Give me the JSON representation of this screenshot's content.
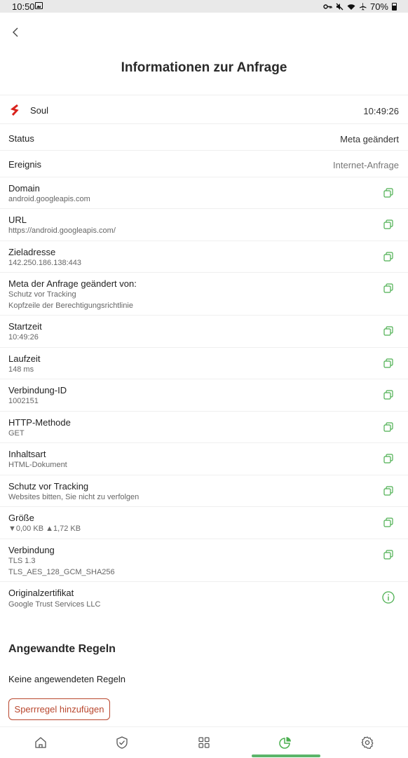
{
  "status_bar": {
    "time": "10:50",
    "battery": "70%",
    "icons": [
      "image-icon",
      "vpn-key-icon",
      "mute-icon",
      "wifi-icon",
      "airplane-icon",
      "battery-icon"
    ]
  },
  "header": {
    "title": "Informationen zur Anfrage"
  },
  "app": {
    "name": "Soul",
    "time": "10:49:26",
    "icon": "soul-logo"
  },
  "status": {
    "label": "Status",
    "value": "Meta geändert"
  },
  "event": {
    "label": "Ereignis",
    "value": "Internet-Anfrage"
  },
  "details": [
    {
      "label": "Domain",
      "lines": [
        "android.googleapis.com"
      ]
    },
    {
      "label": "URL",
      "lines": [
        "https://android.googleapis.com/"
      ]
    },
    {
      "label": "Zieladresse",
      "lines": [
        "142.250.186.138:443"
      ]
    },
    {
      "label": "Meta der Anfrage geändert von:",
      "lines": [
        "Schutz vor Tracking",
        "Kopfzeile der Berechtigungsrichtlinie"
      ]
    },
    {
      "label": "Startzeit",
      "lines": [
        "10:49:26"
      ]
    },
    {
      "label": "Laufzeit",
      "lines": [
        "148 ms"
      ]
    },
    {
      "label": "Verbindung-ID",
      "lines": [
        "1002151"
      ]
    },
    {
      "label": "HTTP-Methode",
      "lines": [
        "GET"
      ]
    },
    {
      "label": "Inhaltsart",
      "lines": [
        "HTML-Dokument"
      ]
    },
    {
      "label": "Schutz vor Tracking",
      "lines": [
        "Websites bitten, Sie nicht zu verfolgen"
      ]
    },
    {
      "label": "Größe",
      "lines": [
        "▼0,00 KB ▲1,72 KB"
      ]
    },
    {
      "label": "Verbindung",
      "lines": [
        "TLS 1.3",
        "TLS_AES_128_GCM_SHA256"
      ]
    }
  ],
  "certificate": {
    "label": "Originalzertifikat",
    "value": "Google Trust Services LLC"
  },
  "rules": {
    "title": "Angewandte Regeln",
    "empty": "Keine angewendeten Regeln",
    "add_button": "Sperrregel hinzufügen"
  },
  "bottom_nav": {
    "items": [
      "home-icon",
      "shield-icon",
      "apps-icon",
      "statistics-icon",
      "settings-icon"
    ],
    "active": "statistics-icon"
  },
  "colors": {
    "accent_green": "#5bb56a",
    "button_red": "#b9472e",
    "logo_red": "#d9221c"
  }
}
